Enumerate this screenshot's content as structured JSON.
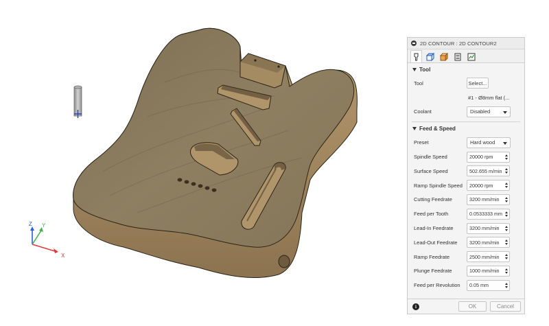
{
  "panel": {
    "title": "2D CONTOUR : 2D CONTOUR2",
    "tabs": [
      {
        "name": "tool-tab-icon"
      },
      {
        "name": "geometry-tab-icon"
      },
      {
        "name": "heights-tab-icon"
      },
      {
        "name": "passes-tab-icon"
      },
      {
        "name": "linking-tab-icon"
      }
    ],
    "tool_section": {
      "header": "Tool",
      "tool_label": "Tool",
      "select_button": "Select...",
      "tool_desc": "#1 - Ø8mm flat (...",
      "coolant_label": "Coolant",
      "coolant_value": "Disabled"
    },
    "feed_section": {
      "header": "Feed & Speed",
      "preset_label": "Preset",
      "preset_value": "Hard wood",
      "fields": [
        {
          "label": "Spindle Speed",
          "value": "20000 rpm"
        },
        {
          "label": "Surface Speed",
          "value": "502.655 m/min"
        },
        {
          "label": "Ramp Spindle Speed",
          "value": "20000 rpm"
        },
        {
          "label": "Cutting Feedrate",
          "value": "3200 mm/min"
        },
        {
          "label": "Feed per Tooth",
          "value": "0.0533333 mm"
        },
        {
          "label": "Lead-In Feedrate",
          "value": "3200 mm/min"
        },
        {
          "label": "Lead-Out Feedrate",
          "value": "3200 mm/min"
        },
        {
          "label": "Ramp Feedrate",
          "value": "2500 mm/min"
        },
        {
          "label": "Plunge Feedrate",
          "value": "1000 mm/min"
        },
        {
          "label": "Feed per Revolution",
          "value": "0.05 mm"
        }
      ]
    },
    "footer": {
      "ok": "OK",
      "cancel": "Cancel"
    }
  },
  "axes": {
    "x": "X",
    "y": "Y",
    "z": "Z"
  },
  "colors": {
    "x_axis": "#e03b3b",
    "y_axis": "#3fb34f",
    "z_axis": "#2d5fd6",
    "wood_top": "#8a7a5e",
    "wood_side": "#a38b64"
  }
}
